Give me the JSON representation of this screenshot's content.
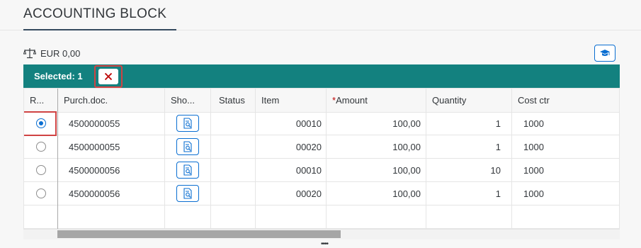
{
  "page": {
    "title": "ACCOUNTING BLOCK"
  },
  "balance": {
    "value": "EUR 0,00",
    "icon": "scale-icon"
  },
  "toolbar": {
    "help_icon": "graduation-cap-icon"
  },
  "selection": {
    "label": "Selected: 1",
    "clear_icon": "close-icon"
  },
  "table": {
    "columns": [
      {
        "key": "radio",
        "label": "R..."
      },
      {
        "key": "purch_doc",
        "label": "Purch.doc."
      },
      {
        "key": "show",
        "label": "Sho..."
      },
      {
        "key": "status",
        "label": "Status"
      },
      {
        "key": "item",
        "label": "Item"
      },
      {
        "key": "amount",
        "label": "Amount",
        "required_marker": "*"
      },
      {
        "key": "quantity",
        "label": "Quantity"
      },
      {
        "key": "cost_ctr",
        "label": "Cost ctr"
      }
    ],
    "rows": [
      {
        "selected": true,
        "purch_doc": "4500000055",
        "status": "",
        "item": "00010",
        "amount": "100,00",
        "quantity": "1",
        "cost_ctr": "1000"
      },
      {
        "selected": false,
        "purch_doc": "4500000055",
        "status": "",
        "item": "00020",
        "amount": "100,00",
        "quantity": "1",
        "cost_ctr": "1000"
      },
      {
        "selected": false,
        "purch_doc": "4500000056",
        "status": "",
        "item": "00010",
        "amount": "100,00",
        "quantity": "10",
        "cost_ctr": "1000"
      },
      {
        "selected": false,
        "purch_doc": "4500000056",
        "status": "",
        "item": "00020",
        "amount": "100,00",
        "quantity": "1",
        "cost_ctr": "1000"
      }
    ],
    "show_icon": "document-search-icon"
  },
  "colors": {
    "accent": "#13817f",
    "link": "#0a6ed1",
    "highlight": "#d04343",
    "required": "#bb0000"
  }
}
